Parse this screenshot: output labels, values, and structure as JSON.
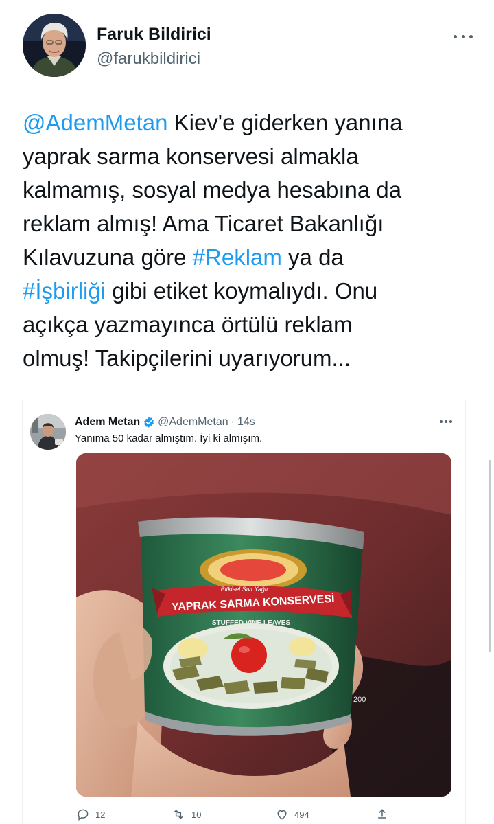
{
  "tweet": {
    "author": {
      "name": "Faruk Bildirici",
      "handle": "@farukbildirici"
    },
    "lines": [
      [
        {
          "text": "@AdemMetan",
          "link": true
        },
        {
          "text": " Kiev'e giderken yanına",
          "link": false
        }
      ],
      [
        {
          "text": "yaprak sarma konservesi almakla",
          "link": false
        }
      ],
      [
        {
          "text": "kalmamış, sosyal medya hesabına da",
          "link": false
        }
      ],
      [
        {
          "text": "reklam almış! Ama Ticaret Bakanlığı",
          "link": false
        }
      ],
      [
        {
          "text": "Kılavuzuna göre ",
          "link": false
        },
        {
          "text": "#Reklam",
          "link": true
        },
        {
          "text": " ya da",
          "link": false
        }
      ],
      [
        {
          "text": "#İşbirliği",
          "link": true
        },
        {
          "text": " gibi etiket koymalıydı. Onu",
          "link": false
        }
      ],
      [
        {
          "text": "açıkça yazmayınca örtülü reklam",
          "link": false
        }
      ],
      [
        {
          "text": "olmuş! Takipçilerini uyarıyorum...",
          "link": false
        }
      ]
    ]
  },
  "quoted": {
    "name": "Adem Metan",
    "handle": "@AdemMetan",
    "separator": "·",
    "time": "14s",
    "text": "Yanıma 50 kadar almıştım. İyi ki almışım.",
    "image": {
      "brand_line": "Bitkisel Sıvı Yağlı",
      "product_name": "YAPRAK SARMA KONSERVESİ",
      "product_subtitle": "STUFFED VINE LEAVES",
      "weight_partial": "200"
    },
    "actions": {
      "reply_count": "12",
      "retweet_count": "10",
      "like_count": "494"
    }
  },
  "colors": {
    "link": "#1d9bf0",
    "secondary_text": "#536471",
    "primary_text": "#0f1419",
    "verified": "#1d9bf0"
  },
  "icons": [
    "more-horizontal-icon",
    "verified-badge-icon",
    "reply-icon",
    "retweet-icon",
    "like-icon",
    "share-icon"
  ]
}
